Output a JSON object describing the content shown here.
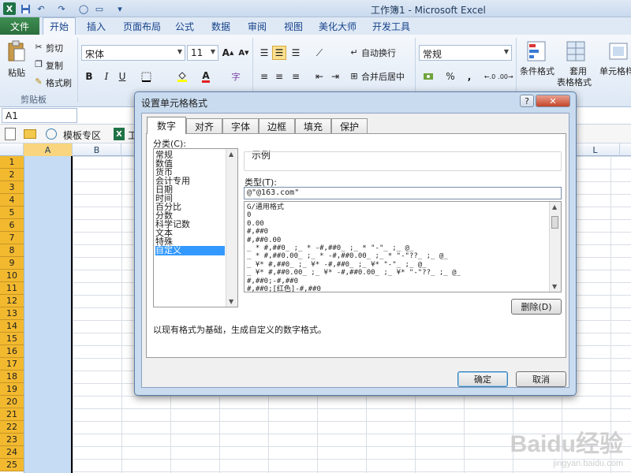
{
  "window": {
    "title": "工作簿1 - Microsoft Excel"
  },
  "tabs": {
    "file": "文件",
    "items": [
      "开始",
      "插入",
      "页面布局",
      "公式",
      "数据",
      "审阅",
      "视图",
      "美化大师",
      "开发工具"
    ]
  },
  "ribbon": {
    "clipboard": {
      "paste": "粘贴",
      "cut": "剪切",
      "copy": "复制",
      "format_painter": "格式刷",
      "group": "剪贴板"
    },
    "font": {
      "name": "宋体",
      "size": "11",
      "bold": "B",
      "italic": "I",
      "underline": "U",
      "font_color": "A"
    },
    "alignment": {
      "wrap": "自动换行",
      "merge": "合并后居中"
    },
    "number": {
      "format": "常规",
      "percent": "%",
      "comma": ","
    },
    "styles": {
      "conditional": "条件格式",
      "table": "套用",
      "table2": "表格格式",
      "cell": "单元格样"
    },
    "cut_label": "字"
  },
  "formula_bar": {
    "name_box": "A1"
  },
  "sheet_bar": {
    "template": "模板专区",
    "workbook_tab": "工"
  },
  "grid": {
    "columns": [
      "A",
      "B",
      "L"
    ],
    "rows": [
      "1",
      "2",
      "3",
      "4",
      "5",
      "6",
      "7",
      "8",
      "9",
      "10",
      "11",
      "12",
      "13",
      "14",
      "15",
      "16",
      "17",
      "18",
      "19",
      "20",
      "21",
      "22",
      "23",
      "24",
      "25"
    ]
  },
  "dialog": {
    "title": "设置单元格格式",
    "help": "?",
    "close": "✕",
    "tabs": [
      "数字",
      "对齐",
      "字体",
      "边框",
      "填充",
      "保护"
    ],
    "category_label": "分类(C):",
    "categories": [
      "常规",
      "数值",
      "货币",
      "会计专用",
      "日期",
      "时间",
      "百分比",
      "分数",
      "科学记数",
      "文本",
      "特殊",
      "自定义"
    ],
    "selected_category": "自定义",
    "sample_label": "示例",
    "type_label": "类型(T):",
    "type_value": "@\"@163.com\"",
    "formats": [
      "G/通用格式",
      "0",
      "0.00",
      "#,##0",
      "#,##0.00",
      "_ * #,##0_ ;_ * -#,##0_ ;_ * \"-\"_ ;_ @_",
      "_ * #,##0.00_ ;_ * -#,##0.00_ ;_ * \"-\"??_ ;_ @_",
      "_ ¥* #,##0_ ;_ ¥* -#,##0_ ;_ ¥* \"-\"_ ;_ @_",
      "_ ¥* #,##0.00_ ;_ ¥* -#,##0.00_ ;_ ¥* \"-\"??_ ;_ @_",
      "#,##0;-#,##0",
      "#,##0;[红色]-#,##0"
    ],
    "delete_button": "删除(D)",
    "description": "以现有格式为基础，生成自定义的数字格式。",
    "ok_button": "确定",
    "cancel_button": "取消"
  },
  "watermark": {
    "brand": "Baidu经验",
    "url": "jingyan.baidu.com"
  }
}
